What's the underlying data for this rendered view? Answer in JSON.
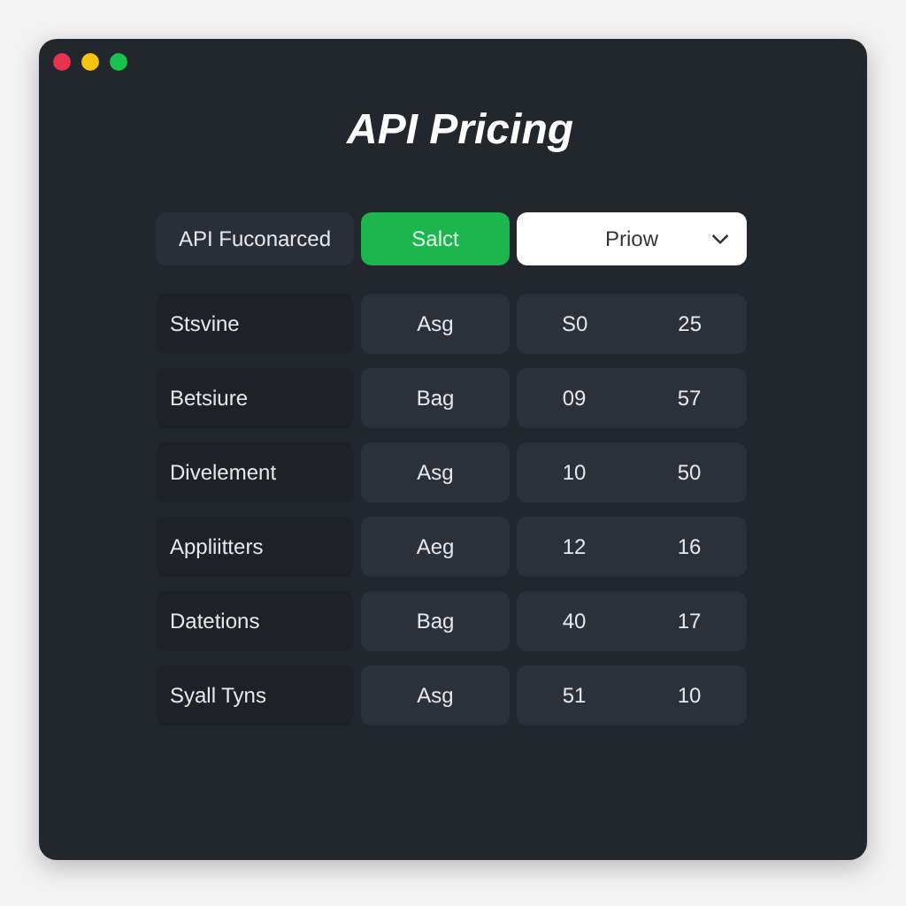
{
  "window": {
    "title": "API Pricing"
  },
  "toolbar": {
    "filter": "API Fuconarced",
    "button": "Salct",
    "dropdown": "Priow"
  },
  "rows": [
    {
      "name": "Stsvine",
      "tier": "Asg",
      "column_3": "S0",
      "column_4": "25"
    },
    {
      "name": "Betsiure",
      "tier": "Bag",
      "column_3": "09",
      "column_4": "57"
    },
    {
      "name": "Divelement",
      "tier": "Asg",
      "column_3": "10",
      "column_4": "50"
    },
    {
      "name": "Appliitters",
      "tier": "Aeg",
      "column_3": "12",
      "column_4": "16"
    },
    {
      "name": "Datetions",
      "tier": "Bag",
      "column_3": "40",
      "column_4": "17"
    },
    {
      "name": "Syall Tyns",
      "tier": "Asg",
      "column_3": "51",
      "column_4": "10"
    }
  ]
}
